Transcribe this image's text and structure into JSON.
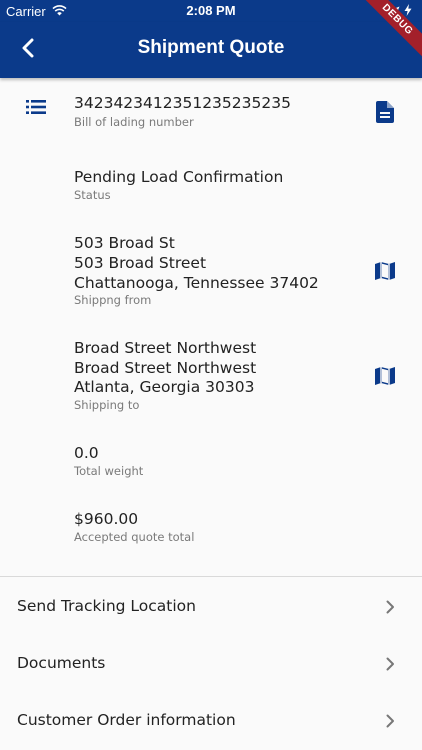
{
  "status_bar": {
    "carrier": "Carrier",
    "time": "2:08 PM",
    "icons": [
      "wifi-icon",
      "location-arrow-icon",
      "charging-icon"
    ]
  },
  "app_bar": {
    "title": "Shipment Quote",
    "back_icon": "chevron-left-icon",
    "debug_banner": "DEBUG",
    "color": "#0b3a8a"
  },
  "details": {
    "bill_of_lading": {
      "value": "342342341235123523523 5",
      "label": "Bill of lading number",
      "lead_icon": "list-icon",
      "trail_icon": "document-icon"
    },
    "status": {
      "value": "Pending Load Confirmation",
      "label": "Status"
    },
    "shipping_from": {
      "lines": [
        "503 Broad St",
        "503 Broad Street",
        "Chattanooga, Tennessee 37402"
      ],
      "label": "Shippng from",
      "trail_icon": "map-icon"
    },
    "shipping_to": {
      "lines": [
        "Broad Street Northwest",
        "Broad Street Northwest",
        "Atlanta, Georgia 30303"
      ],
      "label": "Shipping to",
      "trail_icon": "map-icon"
    },
    "total_weight": {
      "value": "0.0",
      "label": "Total weight"
    },
    "quote_total": {
      "value": "$960.00",
      "label": "Accepted quote total"
    }
  },
  "nav_items": [
    {
      "label": "Send Tracking Location"
    },
    {
      "label": "Documents"
    },
    {
      "label": "Customer Order information"
    }
  ]
}
